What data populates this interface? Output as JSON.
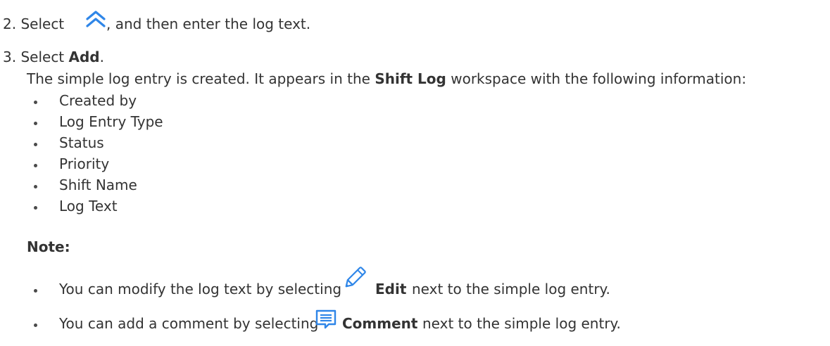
{
  "steps": [
    {
      "number": "2.",
      "text_before_icon": "Select",
      "icon": "double-chevron-up-icon",
      "text_after_icon": ", and then enter the log text."
    },
    {
      "number": "3.",
      "text_before": "Select",
      "bold": "Add",
      "text_after": ".",
      "result": {
        "before": "The simple log entry is created. It appears in the",
        "bold": "Shift Log",
        "after": "workspace with the following information:"
      },
      "info_items": [
        "Created by",
        "Log Entry Type",
        "Status",
        "Priority",
        "Shift Name",
        "Log Text"
      ]
    }
  ],
  "note": {
    "heading": "Note:",
    "items": [
      {
        "before": "You can modify the log text by selecting",
        "icon": "pencil-edit-icon",
        "bold": "Edit",
        "after": "next to the simple log entry."
      },
      {
        "before": "You can add a comment by selecting",
        "icon": "comment-icon",
        "bold": "Comment",
        "after": "next to the simple log entry."
      }
    ]
  },
  "colors": {
    "text": "#333333",
    "icon_blue": "#2f86e8"
  }
}
